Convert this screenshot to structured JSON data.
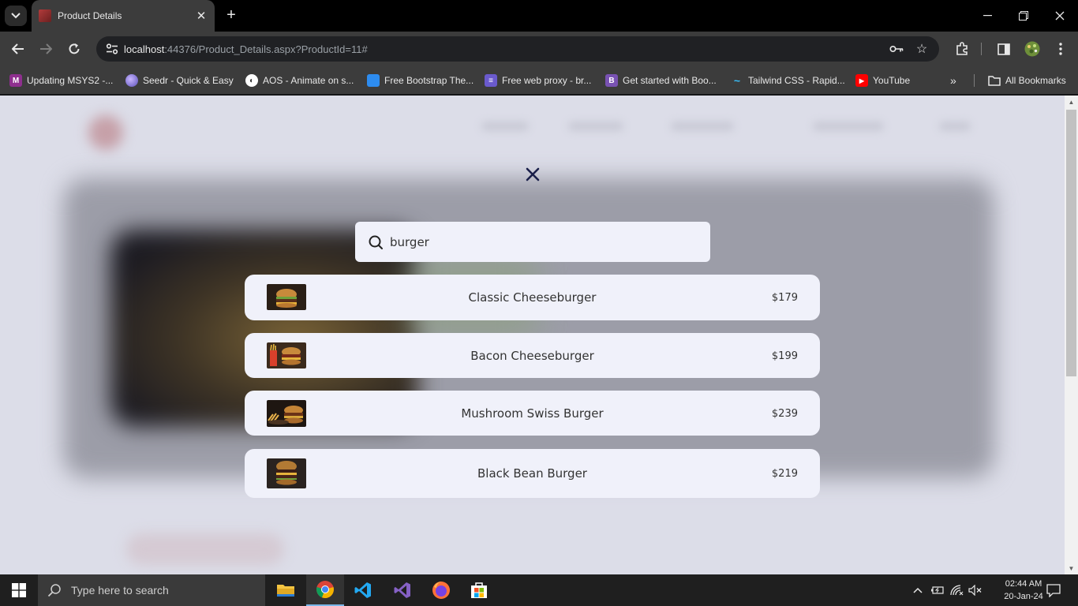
{
  "browser": {
    "tab_title": "Product Details",
    "new_tab_label": "+",
    "url_host": "localhost",
    "url_rest": ":44376/Product_Details.aspx?ProductId=11#",
    "bookmarks": [
      {
        "label": "Updating MSYS2 -...",
        "icon": "msys2-icon",
        "color": "#8e2f8e",
        "glyph": "M"
      },
      {
        "label": "Seedr - Quick & Easy",
        "icon": "seedr-icon",
        "color": "#7f7fd5",
        "glyph": ""
      },
      {
        "label": "AOS - Animate on s...",
        "icon": "aos-icon",
        "color": "#ffffff",
        "glyph": ""
      },
      {
        "label": "Free Bootstrap The...",
        "icon": "bootstrap-theme-icon",
        "color": "#2d8cf0",
        "glyph": ""
      },
      {
        "label": "Free web proxy - br...",
        "icon": "proxy-icon",
        "color": "#6a5acd",
        "glyph": "≡"
      },
      {
        "label": "Get started with Boo...",
        "icon": "bootstrap-icon",
        "color": "#7952b3",
        "glyph": "B"
      },
      {
        "label": "Tailwind CSS - Rapid...",
        "icon": "tailwind-icon",
        "color": "#38bdf8",
        "glyph": "~"
      },
      {
        "label": "YouTube",
        "icon": "youtube-icon",
        "color": "#ff0000",
        "glyph": "▶"
      }
    ],
    "all_bookmarks_label": "All Bookmarks"
  },
  "search": {
    "query": "burger",
    "placeholder": "Search"
  },
  "results": [
    {
      "name": "Classic Cheeseburger",
      "price": "$179"
    },
    {
      "name": "Bacon Cheeseburger",
      "price": "$199"
    },
    {
      "name": "Mushroom Swiss Burger",
      "price": "$239"
    },
    {
      "name": "Black Bean Burger",
      "price": "$219"
    }
  ],
  "taskbar": {
    "search_placeholder": "Type here to search",
    "time": "02:44 AM",
    "date": "20-Jan-24"
  },
  "colors": {
    "overlay_bg": "#dcdde8",
    "card_bg": "#f0f1fa",
    "close_x": "#1a1f4a"
  }
}
